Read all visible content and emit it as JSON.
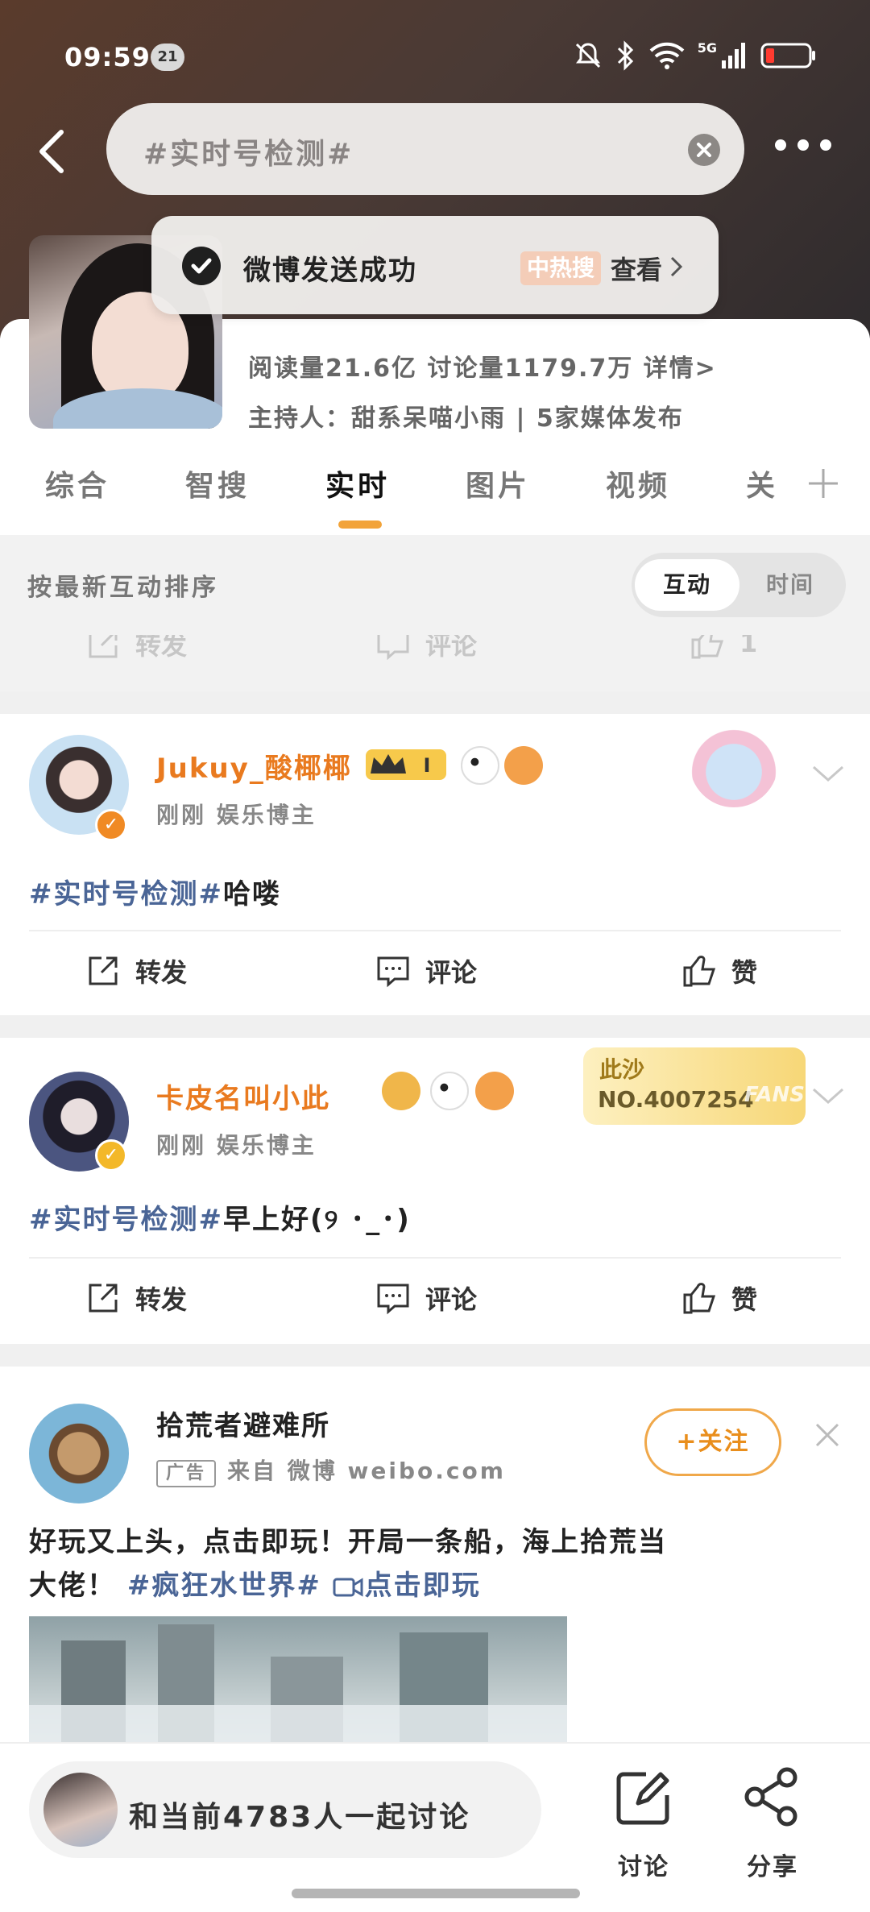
{
  "status_bar": {
    "time": "09:59",
    "notification_count": "21",
    "network": "5G"
  },
  "header": {
    "search_text": "#实时号检测#"
  },
  "toast": {
    "message": "微博发送成功",
    "hot_label": "中热搜",
    "view_label": "查看"
  },
  "topic": {
    "stats": "阅读量21.6亿  讨论量1179.7万  详情>",
    "host": "主持人：甜系呆喵小雨 | 5家媒体发布"
  },
  "tabs": [
    "综合",
    "智搜",
    "实时",
    "图片",
    "视频",
    "关"
  ],
  "active_tab": "实时",
  "sort": {
    "label": "按最新互动排序",
    "option_active": "互动",
    "option_inactive": "时间"
  },
  "faded_actions": {
    "repost": "转发",
    "comment": "评论",
    "like_count": "1"
  },
  "posts": [
    {
      "username": "Jukuy_酸椰椰",
      "level": "I",
      "meta": "刚刚  娱乐博主",
      "tag": "#实时号检测#",
      "text": "哈喽",
      "actions": {
        "repost": "转发",
        "comment": "评论",
        "like": "赞"
      },
      "name_color": "#e97a1f"
    },
    {
      "username": "卡皮名叫小此",
      "meta": "刚刚  娱乐博主",
      "tag": "#实时号检测#",
      "text": "早上好(୨ ･_･)",
      "fans_badge": {
        "name": "此沙",
        "number": "NO.4007254",
        "watermark": "FANS"
      },
      "actions": {
        "repost": "转发",
        "comment": "评论",
        "like": "赞"
      },
      "name_color": "#e97a1f"
    }
  ],
  "ad": {
    "username": "拾荒者避难所",
    "ad_tag": "广告",
    "source": "来自 微博 weibo.com",
    "follow_label": "+关注",
    "text_line1": "好玩又上头，点击即玩！开局一条船，海上拾荒当",
    "text_line2_plain": "大佬！",
    "text_line2_tag": "#疯狂水世界#",
    "text_line2_link": "点击即玩"
  },
  "bottom_bar": {
    "discuss_prompt": "和当前4783人一起讨论",
    "discuss_button": "讨论",
    "share_button": "分享"
  },
  "colors": {
    "accent": "#f2a33a",
    "tag_blue": "#4a6596",
    "username_orange": "#e97a1f"
  }
}
